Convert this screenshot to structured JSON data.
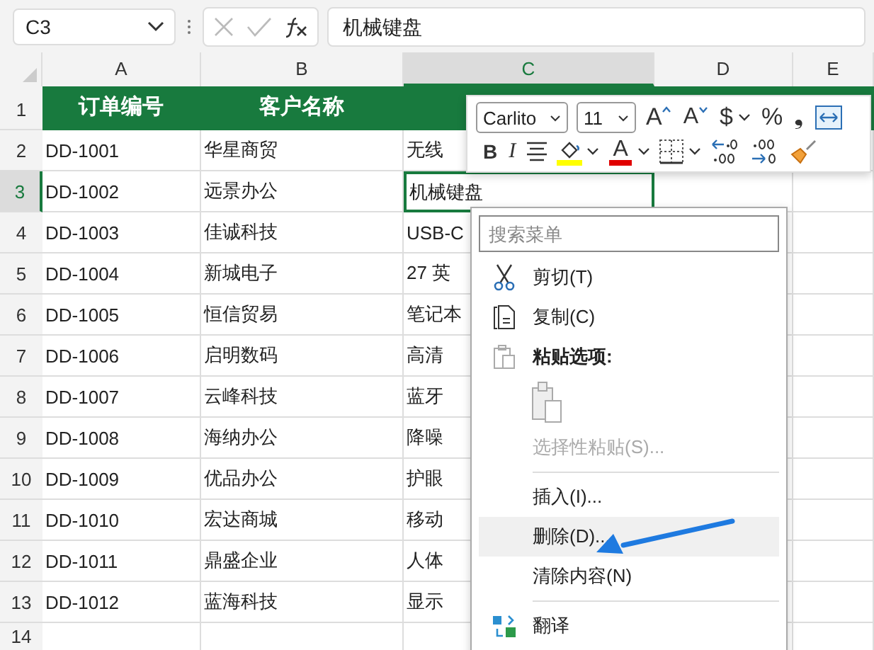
{
  "name_box": "C3",
  "formula": "机械键盘",
  "columns": [
    {
      "label": "A",
      "selected": false
    },
    {
      "label": "B",
      "selected": false
    },
    {
      "label": "C",
      "selected": true
    },
    {
      "label": "D",
      "selected": false
    },
    {
      "label": "E",
      "selected": false
    }
  ],
  "rows": [
    {
      "number": "1",
      "kind": "header",
      "selected": false,
      "cells": [
        "订单编号",
        "客户名称"
      ]
    },
    {
      "number": "2",
      "kind": "data",
      "selected": false,
      "cells": [
        "DD-1001",
        "华星商贸",
        "无线"
      ]
    },
    {
      "number": "3",
      "kind": "data",
      "selected": true,
      "cells": [
        "DD-1002",
        "远景办公",
        "机械键盘"
      ]
    },
    {
      "number": "4",
      "kind": "data",
      "selected": false,
      "cells": [
        "DD-1003",
        "佳诚科技",
        "USB-C"
      ]
    },
    {
      "number": "5",
      "kind": "data",
      "selected": false,
      "cells": [
        "DD-1004",
        "新城电子",
        "27 英"
      ]
    },
    {
      "number": "6",
      "kind": "data",
      "selected": false,
      "cells": [
        "DD-1005",
        "恒信贸易",
        "笔记本"
      ]
    },
    {
      "number": "7",
      "kind": "data",
      "selected": false,
      "cells": [
        "DD-1006",
        "启明数码",
        "高清"
      ]
    },
    {
      "number": "8",
      "kind": "data",
      "selected": false,
      "cells": [
        "DD-1007",
        "云峰科技",
        "蓝牙"
      ]
    },
    {
      "number": "9",
      "kind": "data",
      "selected": false,
      "cells": [
        "DD-1008",
        "海纳办公",
        "降噪"
      ]
    },
    {
      "number": "10",
      "kind": "data",
      "selected": false,
      "cells": [
        "DD-1009",
        "优品办公",
        "护眼"
      ]
    },
    {
      "number": "11",
      "kind": "data",
      "selected": false,
      "cells": [
        "DD-1010",
        "宏达商城",
        "移动"
      ]
    },
    {
      "number": "12",
      "kind": "data",
      "selected": false,
      "cells": [
        "DD-1011",
        "鼎盛企业",
        "人体"
      ]
    },
    {
      "number": "13",
      "kind": "data",
      "selected": false,
      "cells": [
        "DD-1012",
        "蓝海科技",
        "显示"
      ]
    },
    {
      "number": "14",
      "kind": "data",
      "selected": false,
      "cells": []
    }
  ],
  "mini_toolbar": {
    "font": "Carlito",
    "size": "11",
    "row1": [
      {
        "kind": "grow",
        "text": "A"
      },
      {
        "kind": "shrink",
        "text": "A"
      },
      {
        "kind": "glyph",
        "text": "$"
      },
      {
        "kind": "caret"
      },
      {
        "kind": "glyph",
        "text": "%"
      },
      {
        "kind": "glyph",
        "text": "❟"
      },
      {
        "kind": "wrap"
      }
    ],
    "row2": [
      {
        "kind": "bold",
        "text": "B"
      },
      {
        "kind": "italic",
        "text": "I"
      },
      {
        "kind": "align"
      },
      {
        "kind": "fill",
        "color": "#ffff00"
      },
      {
        "kind": "caret"
      },
      {
        "kind": "fontcolor",
        "text": "A",
        "color": "#e00000"
      },
      {
        "kind": "caret"
      },
      {
        "kind": "borders"
      },
      {
        "kind": "caret"
      },
      {
        "kind": "decleft"
      },
      {
        "kind": "decright"
      },
      {
        "kind": "painter"
      }
    ]
  },
  "context_menu": {
    "search_placeholder": "搜索菜单",
    "items": [
      {
        "kind": "cut",
        "label": "剪切(T)",
        "disabled": false,
        "selected": false
      },
      {
        "kind": "copy",
        "label": "复制(C)",
        "disabled": false,
        "selected": false
      },
      {
        "kind": "heading",
        "label": "粘贴选项:"
      },
      {
        "kind": "paste"
      },
      {
        "kind": "command",
        "label": "选择性粘贴(S)...",
        "disabled": true,
        "selected": false
      },
      {
        "kind": "separator"
      },
      {
        "kind": "command",
        "label": "插入(I)...",
        "disabled": false,
        "selected": false
      },
      {
        "kind": "command",
        "label": "删除(D)...",
        "disabled": false,
        "selected": true
      },
      {
        "kind": "command",
        "label": "清除内容(N)",
        "disabled": false,
        "selected": false
      },
      {
        "kind": "separator"
      },
      {
        "kind": "translate",
        "label": "翻译",
        "disabled": false,
        "selected": false
      }
    ]
  }
}
